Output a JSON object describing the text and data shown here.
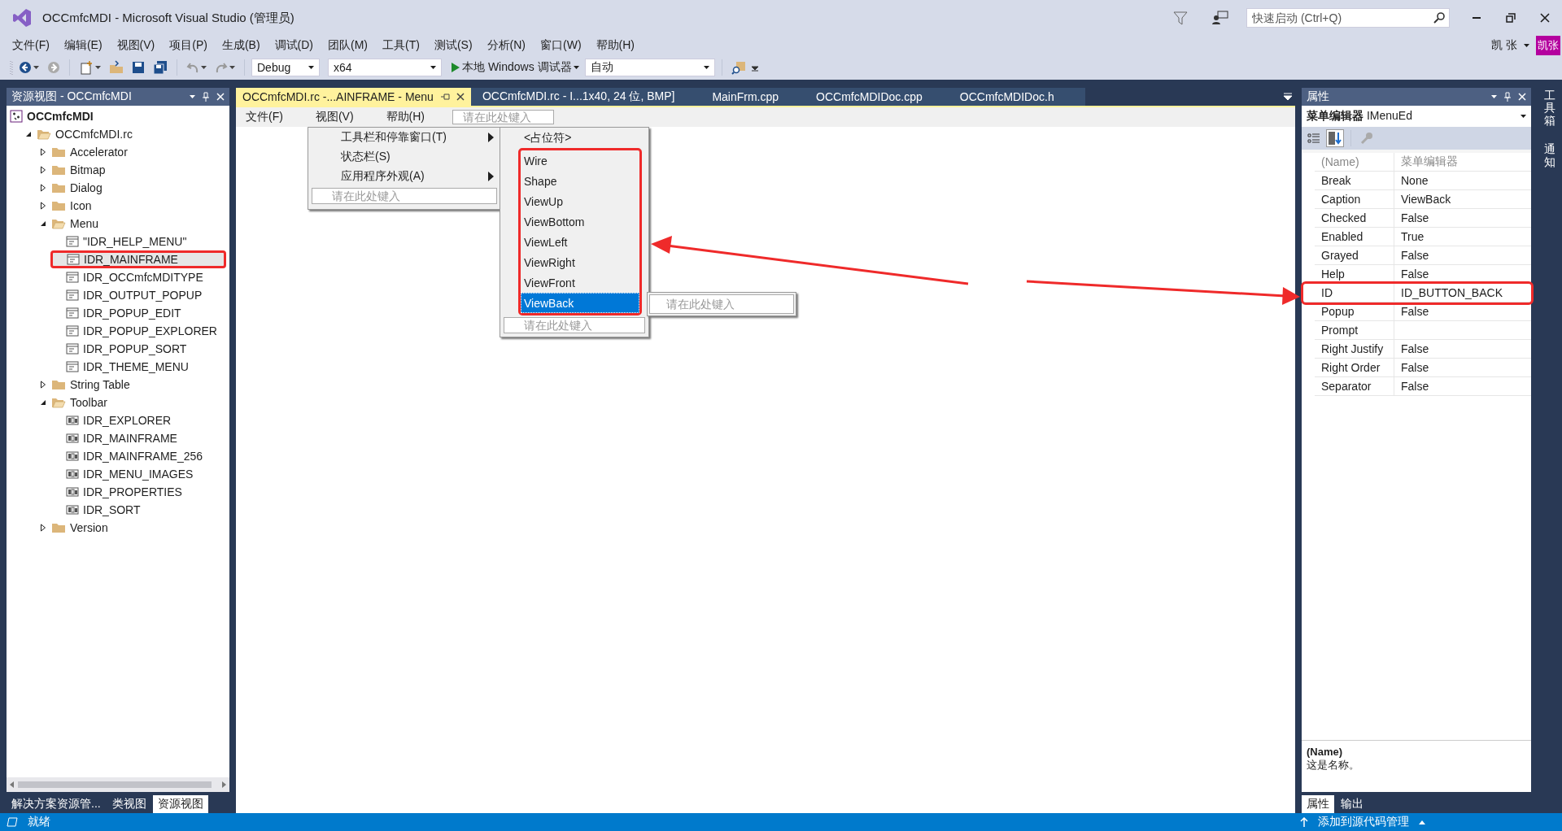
{
  "window": {
    "title": "OCCmfcMDI - Microsoft Visual Studio (管理员)"
  },
  "quick_launch": {
    "placeholder": "快速启动 (Ctrl+Q)"
  },
  "user": {
    "name": "凯 张",
    "avatar": "凯张"
  },
  "menu_bar": [
    "文件(F)",
    "编辑(E)",
    "视图(V)",
    "项目(P)",
    "生成(B)",
    "调试(D)",
    "团队(M)",
    "工具(T)",
    "测试(S)",
    "分析(N)",
    "窗口(W)",
    "帮助(H)"
  ],
  "toolbar": {
    "configuration": "Debug",
    "platform": "x64",
    "debugger": "本地 Windows 调试器",
    "target": "自动"
  },
  "resource_view": {
    "title": "资源视图 - OCCmfcMDI",
    "tree": [
      {
        "label": "OCCmfcMDI",
        "kind": "project",
        "selected": false,
        "annotated": false,
        "children": [
          {
            "label": "OCCmfcMDI.rc",
            "kind": "rc",
            "expanded": true,
            "selected": false,
            "annotated": false,
            "children": [
              {
                "label": "Accelerator",
                "kind": "folder",
                "expanded": false,
                "selected": false,
                "annotated": false
              },
              {
                "label": "Bitmap",
                "kind": "folder",
                "expanded": false,
                "selected": false,
                "annotated": false
              },
              {
                "label": "Dialog",
                "kind": "folder",
                "expanded": false,
                "selected": false,
                "annotated": false
              },
              {
                "label": "Icon",
                "kind": "folder",
                "expanded": false,
                "selected": false,
                "annotated": false
              },
              {
                "label": "Menu",
                "kind": "folder",
                "expanded": true,
                "selected": false,
                "annotated": false,
                "children": [
                  {
                    "label": "\"IDR_HELP_MENU\"",
                    "kind": "menu",
                    "selected": false,
                    "annotated": false
                  },
                  {
                    "label": "IDR_MAINFRAME",
                    "kind": "menu",
                    "selected": true,
                    "annotated": true
                  },
                  {
                    "label": "IDR_OCCmfcMDITYPE",
                    "kind": "menu",
                    "selected": false,
                    "annotated": false
                  },
                  {
                    "label": "IDR_OUTPUT_POPUP",
                    "kind": "menu",
                    "selected": false,
                    "annotated": false
                  },
                  {
                    "label": "IDR_POPUP_EDIT",
                    "kind": "menu",
                    "selected": false,
                    "annotated": false
                  },
                  {
                    "label": "IDR_POPUP_EXPLORER",
                    "kind": "menu",
                    "selected": false,
                    "annotated": false
                  },
                  {
                    "label": "IDR_POPUP_SORT",
                    "kind": "menu",
                    "selected": false,
                    "annotated": false
                  },
                  {
                    "label": "IDR_THEME_MENU",
                    "kind": "menu",
                    "selected": false,
                    "annotated": false
                  }
                ]
              },
              {
                "label": "String Table",
                "kind": "folder",
                "expanded": false,
                "selected": false,
                "annotated": false
              },
              {
                "label": "Toolbar",
                "kind": "folder",
                "expanded": true,
                "selected": false,
                "annotated": false,
                "children": [
                  {
                    "label": "IDR_EXPLORER",
                    "kind": "toolbar",
                    "selected": false,
                    "annotated": false
                  },
                  {
                    "label": "IDR_MAINFRAME",
                    "kind": "toolbar",
                    "selected": false,
                    "annotated": false
                  },
                  {
                    "label": "IDR_MAINFRAME_256",
                    "kind": "toolbar",
                    "selected": false,
                    "annotated": false
                  },
                  {
                    "label": "IDR_MENU_IMAGES",
                    "kind": "toolbar",
                    "selected": false,
                    "annotated": false
                  },
                  {
                    "label": "IDR_PROPERTIES",
                    "kind": "toolbar",
                    "selected": false,
                    "annotated": false
                  },
                  {
                    "label": "IDR_SORT",
                    "kind": "toolbar",
                    "selected": false,
                    "annotated": false
                  }
                ]
              },
              {
                "label": "Version",
                "kind": "folder",
                "expanded": false,
                "selected": false,
                "annotated": false
              }
            ]
          }
        ]
      }
    ],
    "bottom_tabs": [
      {
        "label": "解决方案资源管...",
        "selected": false
      },
      {
        "label": "类视图",
        "selected": false
      },
      {
        "label": "资源视图",
        "selected": true
      }
    ]
  },
  "editor": {
    "tabs": [
      {
        "label": "OCCmfcMDI.rc -...AINFRAME - Menu",
        "selected": true
      },
      {
        "label": "OCCmfcMDI.rc - I...1x40, 24 位, BMP]",
        "selected": false
      },
      {
        "label": "MainFrm.cpp",
        "selected": false
      },
      {
        "label": "OCCmfcMDIDoc.cpp",
        "selected": false
      },
      {
        "label": "OCCmfcMDIDoc.h",
        "selected": false
      }
    ],
    "menu_items": [
      "文件(F)",
      "视图(V)",
      "帮助(H)"
    ],
    "menu_placeholder": "请在此处键入",
    "dropdown": {
      "items": [
        {
          "label": "工具栏和停靠窗口(T)",
          "submenu": true
        },
        {
          "label": "状态栏(S)",
          "submenu": false
        },
        {
          "label": "应用程序外观(A)",
          "submenu": true
        }
      ],
      "placeholder": "请在此处键入"
    },
    "submenu": {
      "items": [
        {
          "label": "<占位符>",
          "selected": false,
          "annotated": false
        },
        {
          "label": "Wire",
          "selected": false,
          "annotated": true
        },
        {
          "label": "Shape",
          "selected": false,
          "annotated": true
        },
        {
          "label": "ViewUp",
          "selected": false,
          "annotated": true
        },
        {
          "label": "ViewBottom",
          "selected": false,
          "annotated": true
        },
        {
          "label": "ViewLeft",
          "selected": false,
          "annotated": true
        },
        {
          "label": "ViewRight",
          "selected": false,
          "annotated": true
        },
        {
          "label": "ViewFront",
          "selected": false,
          "annotated": true
        },
        {
          "label": "ViewBack",
          "selected": true,
          "annotated": true
        }
      ],
      "placeholder": "请在此处键入",
      "side_placeholder": "请在此处键入"
    }
  },
  "properties": {
    "title": "属性",
    "object": "**菜单编辑器** IMenuEd",
    "rows": [
      {
        "name": "(Name)",
        "value": "菜单编辑器",
        "grayed": true,
        "annotated": false
      },
      {
        "name": "Break",
        "value": "None",
        "grayed": false,
        "annotated": false
      },
      {
        "name": "Caption",
        "value": "ViewBack",
        "grayed": false,
        "annotated": false
      },
      {
        "name": "Checked",
        "value": "False",
        "grayed": false,
        "annotated": false
      },
      {
        "name": "Enabled",
        "value": "True",
        "grayed": false,
        "annotated": false
      },
      {
        "name": "Grayed",
        "value": "False",
        "grayed": false,
        "annotated": false
      },
      {
        "name": "Help",
        "value": "False",
        "grayed": false,
        "annotated": false
      },
      {
        "name": "ID",
        "value": "ID_BUTTON_BACK",
        "grayed": false,
        "annotated": true
      },
      {
        "name": "Popup",
        "value": "False",
        "grayed": false,
        "annotated": false
      },
      {
        "name": "Prompt",
        "grayed": false,
        "annotated": false
      },
      {
        "name": "Right Justify",
        "value": "False",
        "grayed": false,
        "annotated": false
      },
      {
        "name": "Right Order",
        "value": "False",
        "grayed": false,
        "annotated": false
      },
      {
        "name": "Separator",
        "value": "False",
        "grayed": false,
        "annotated": false
      }
    ],
    "description_title": "(Name)",
    "description": "这是名称。",
    "bottom_tabs": [
      {
        "label": "属性",
        "selected": true
      },
      {
        "label": "输出",
        "selected": false
      }
    ]
  },
  "side_strip": [
    "工具箱",
    "通知"
  ],
  "status_bar": {
    "text": "就绪",
    "source_control": "添加到源代码管理"
  }
}
